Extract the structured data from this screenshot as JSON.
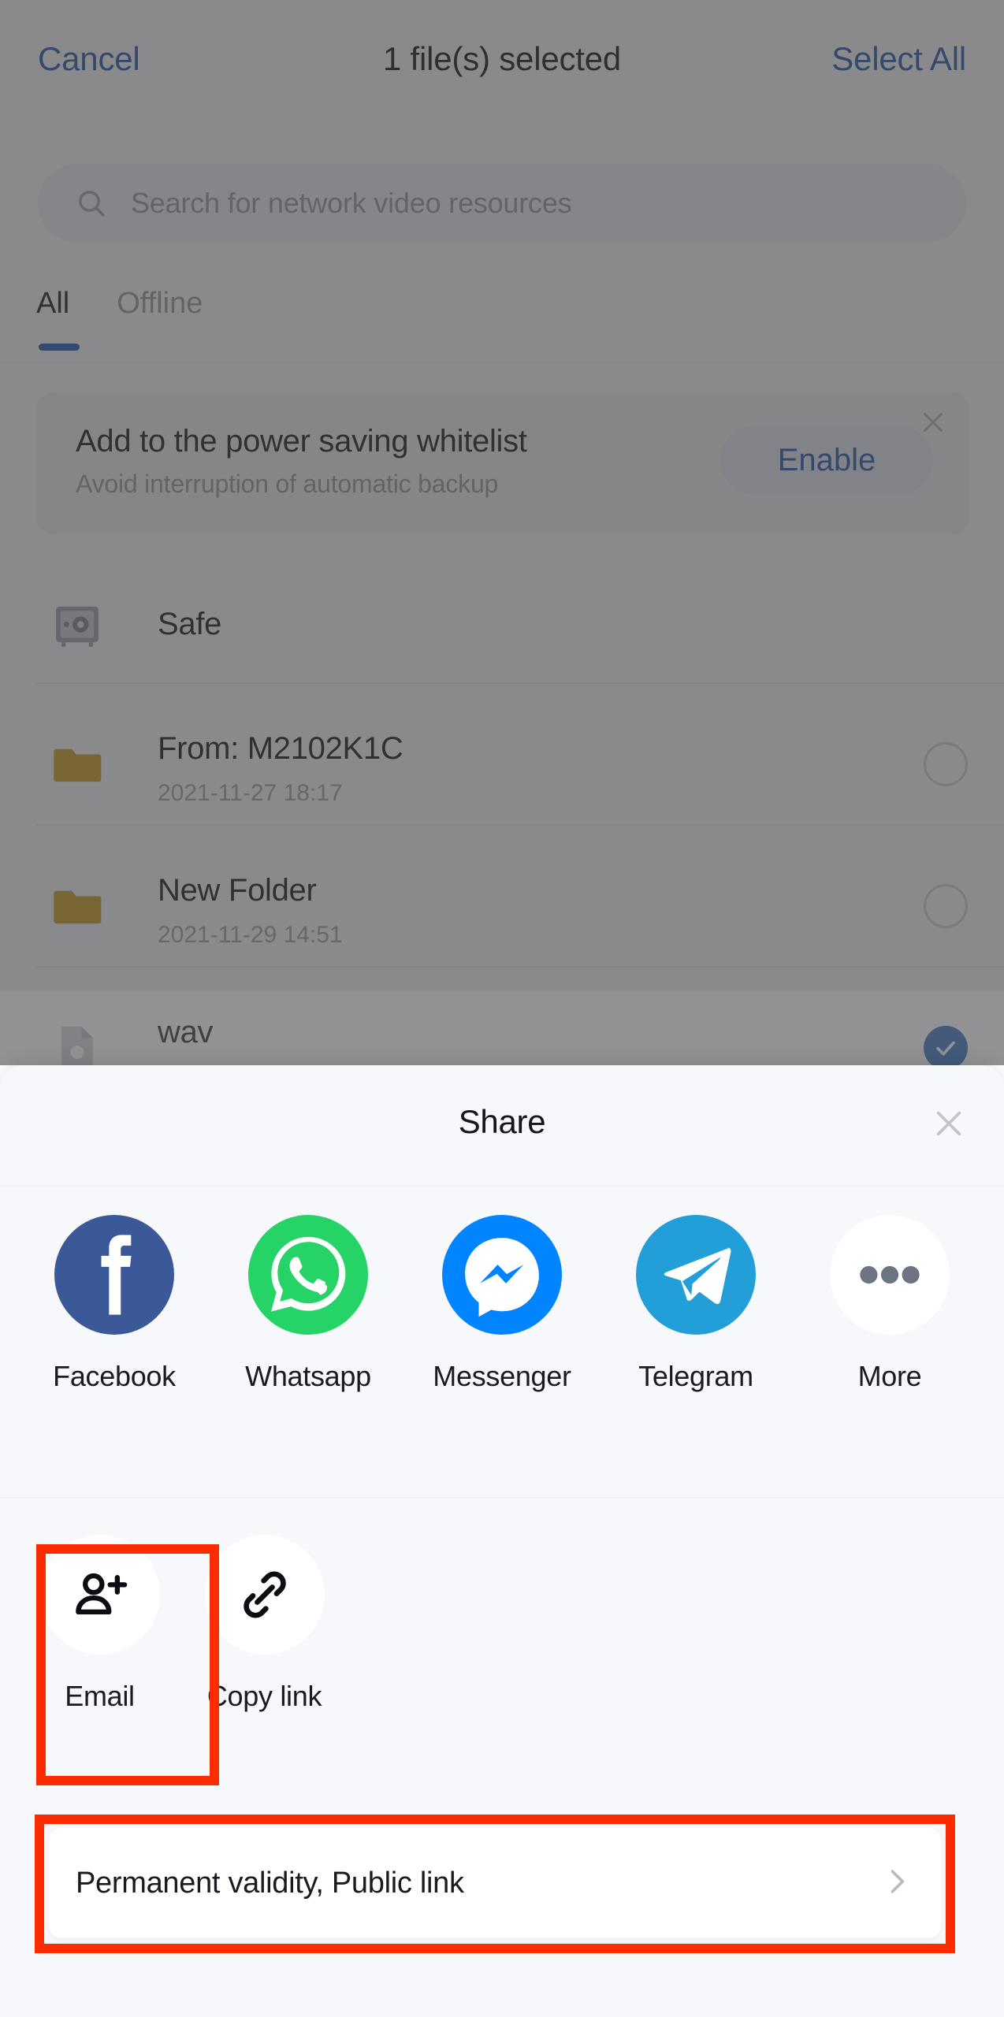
{
  "header": {
    "cancel_label": "Cancel",
    "title": "1 file(s) selected",
    "select_all_label": "Select All"
  },
  "search": {
    "placeholder": "Search for network video resources",
    "icon": "search-icon"
  },
  "tabs": [
    {
      "label": "All",
      "active": true
    },
    {
      "label": "Offline",
      "active": false
    }
  ],
  "power_saving_banner": {
    "title": "Add to the power saving whitelist",
    "subtitle": "Avoid interruption of automatic backup",
    "action_label": "Enable",
    "close_icon": "close-icon"
  },
  "file_list": [
    {
      "name": "Safe",
      "date": "",
      "icon": "safe-vault-icon",
      "selectable": false,
      "checked": false
    },
    {
      "name": "From: M2102K1C",
      "date": "2021-11-27  18:17",
      "icon": "folder-icon",
      "selectable": true,
      "checked": false
    },
    {
      "name": "New Folder",
      "date": "2021-11-29  14:51",
      "icon": "folder-icon",
      "selectable": true,
      "checked": false
    },
    {
      "name": "wav",
      "date": "",
      "icon": "file-icon",
      "selectable": true,
      "checked": true
    }
  ],
  "share_sheet": {
    "title": "Share",
    "close_icon": "close-icon",
    "apps": [
      {
        "label": "Facebook",
        "icon": "facebook-icon",
        "color": "#3b5998"
      },
      {
        "label": "Whatsapp",
        "icon": "whatsapp-icon",
        "color": "#25D366"
      },
      {
        "label": "Messenger",
        "icon": "messenger-icon",
        "color": "#0084FF"
      },
      {
        "label": "Telegram",
        "icon": "telegram-icon",
        "color": "#229ED9"
      },
      {
        "label": "More",
        "icon": "more-dots-icon",
        "color": "#FFFFFF"
      }
    ],
    "actions": [
      {
        "label": "Email",
        "icon": "person-add-icon"
      },
      {
        "label": "Copy link",
        "icon": "link-chain-icon"
      }
    ],
    "link_settings": {
      "label": "Permanent validity, Public link",
      "chevron_icon": "chevron-right-icon"
    }
  },
  "annotations": {
    "highlight_color": "#FA2C00",
    "boxes": [
      {
        "target": "Email"
      },
      {
        "target": "Permanent validity, Public link"
      }
    ]
  }
}
